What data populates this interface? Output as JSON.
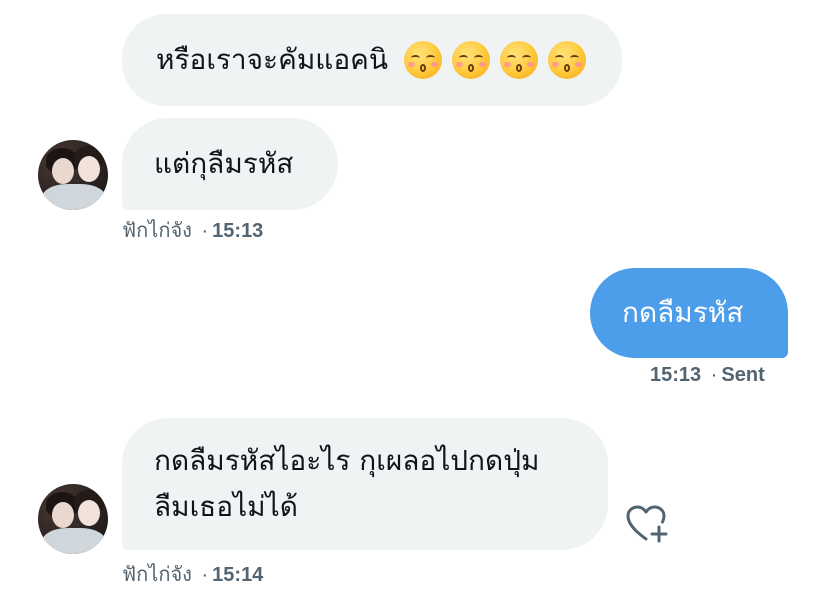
{
  "messages": [
    {
      "direction": "incoming",
      "text": "หรือเราจะคัมแอคนิ",
      "emojis": [
        "kissing-face-smiling-eyes",
        "kissing-face-smiling-eyes",
        "kissing-face-smiling-eyes",
        "kissing-face-smiling-eyes"
      ]
    },
    {
      "direction": "incoming",
      "text": "แต่กุลืมรหัส",
      "sender": "ฟักไก่จัง",
      "separator": "·",
      "time": "15:13"
    },
    {
      "direction": "outgoing",
      "text": "กดลืมรหัส",
      "time": "15:13",
      "separator": "·",
      "status": "Sent"
    },
    {
      "direction": "incoming",
      "lines": [
        "กดลืมรหัสไอะไร กุเผลอไปกดปุ่ม",
        "ลืมเธอไม่ได้"
      ],
      "sender": "ฟักไก่จัง",
      "separator": "·",
      "time": "15:14"
    }
  ],
  "colors": {
    "incoming_bubble": "#eff3f4",
    "outgoing_bubble": "#4c9eeb",
    "meta_text": "#536471"
  },
  "icons": {
    "react": "heart-plus-icon"
  }
}
